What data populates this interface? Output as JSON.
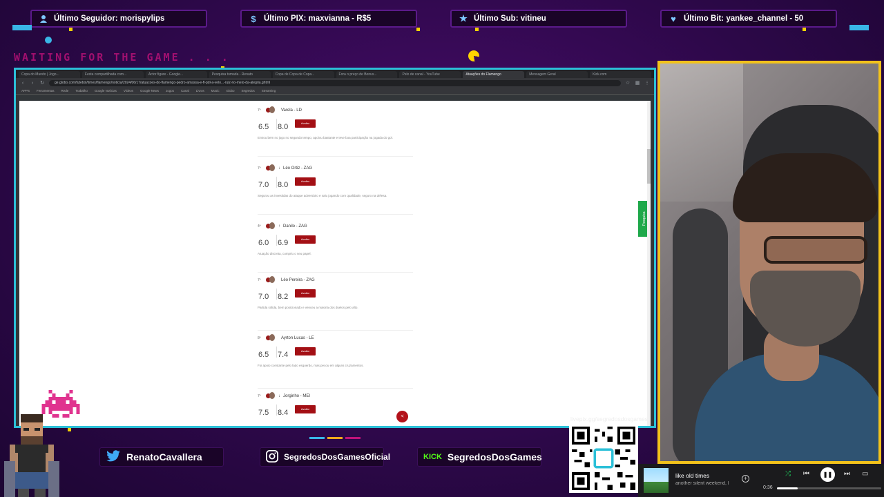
{
  "alerts": [
    {
      "icon": "user-icon",
      "text": "Último Seguidor: morispylips"
    },
    {
      "icon": "dollar-icon",
      "text": "Último PIX: maxvianna - R$5"
    },
    {
      "icon": "star-icon",
      "text": "Último Sub: vitineu"
    },
    {
      "icon": "heart-icon",
      "text": "Último Bit: yankee_channel - 50"
    }
  ],
  "waiting_text": "WAITING FOR THE GAME . . .",
  "browser": {
    "url": "ge.globo.com/futebol/times/flamengo/noticia/2024/06/17/atuacoes-do-flamengo-pedro-amassa-e-fl-pdl-a-velo...-ruiz-no-meio-da-alegria.ghtml",
    "tabs": [
      "Copa do Mundo | Jogo...",
      "Festa compartilhada com...",
      "Actor figure - Google...",
      "Pesquisa tomada - Renato",
      "Copa de Copa de Copa...",
      "Fora o preço de Bonus...",
      "Pelo de canal - YouTube",
      "Atuações do Flamengo",
      "Mensagem Geral",
      "Kick.com"
    ],
    "bookmarks": [
      "APPS",
      "Ferramentas",
      "Rede",
      "Trabalho",
      "Google Notícias",
      "Vídeos",
      "Google News",
      "Jogos",
      "Canal",
      "Livros",
      "Music",
      "Globo",
      "Segredos",
      "Streaming"
    ],
    "ratings": [
      {
        "rank": "7º",
        "arrow": "",
        "name": "Varela - LD",
        "v1": "6.5",
        "v2": "8.0",
        "button": "Avaliar",
        "desc": "Entrou bem no jogo no segundo tempo, apoiou bastante e teve boa participação na jogada do gol."
      },
      {
        "rank": "7º",
        "arrow": "↓",
        "name": "Léo Ortiz - ZAG",
        "v1": "7.0",
        "v2": "8.0",
        "button": "Avaliar",
        "desc": "Segurou as investidas do ataque adversário e saiu jogando com qualidade, seguro na defesa."
      },
      {
        "rank": "4º",
        "arrow": "↑",
        "name": "Danilo - ZAG",
        "v1": "6.0",
        "v2": "6.9",
        "button": "Avaliar",
        "desc": "Atuação discreta, cumpriu o seu papel."
      },
      {
        "rank": "7º",
        "arrow": "",
        "name": "Léo Pereira - ZAG",
        "v1": "7.0",
        "v2": "8.2",
        "button": "Avaliar",
        "desc": "Partida sólida, bem posicionado e venceu a maioria dos duelos pelo alto."
      },
      {
        "rank": "8º",
        "arrow": "",
        "name": "Ayrton Lucas - LE",
        "v1": "6.5",
        "v2": "7.4",
        "button": "Avaliar",
        "desc": "Foi apoio constante pelo lado esquerdo, mas pecou em alguns cruzamentos."
      },
      {
        "rank": "7º",
        "arrow": "↓",
        "name": "Jorginho - MEI",
        "v1": "7.5",
        "v2": "8.4",
        "button": "Avaliar",
        "desc": ""
      }
    ],
    "side_tab": "Pesquisa"
  },
  "socials": [
    {
      "icon": "twitter-icon",
      "text": "RenatoCavallera"
    },
    {
      "icon": "instagram-icon",
      "text": "SegredosDosGamesOficial"
    },
    {
      "icon": "kick-icon",
      "label": "KICK",
      "text": "SegredosDosGames"
    }
  ],
  "qr": {
    "label": "livepix.gg/segredosdosgames"
  },
  "player": {
    "song": "like old times",
    "artist": "another silent weekend, l",
    "time": "0:36",
    "progress": 0.2,
    "controls": [
      "shuffle-icon",
      "previous-icon",
      "pause-icon",
      "next-icon",
      "device-icon"
    ]
  },
  "colors": {
    "accent": "#2cc0d8",
    "frame": "#f2c21b",
    "alert_bg": "#1a0428",
    "button_red": "#a30f14"
  }
}
